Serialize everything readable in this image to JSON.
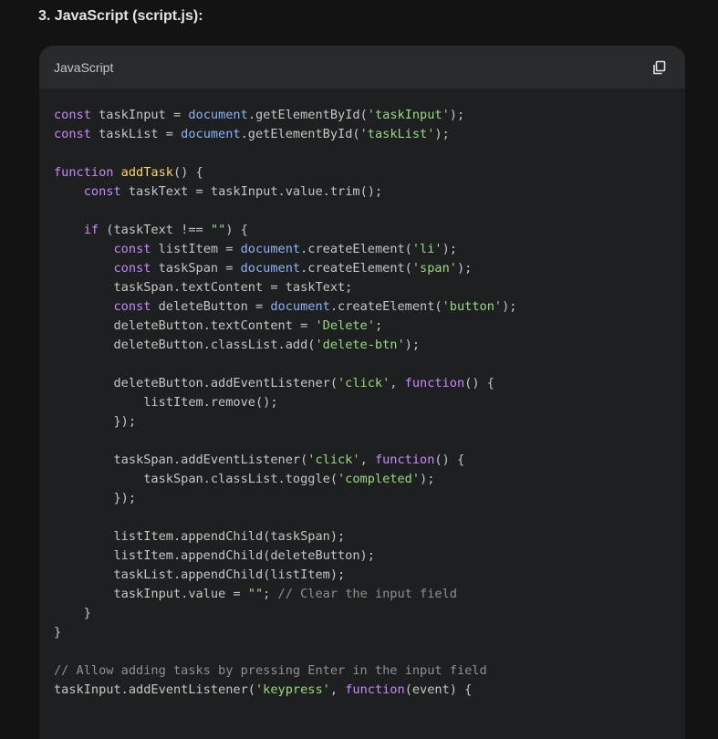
{
  "heading": "3. JavaScript (script.js):",
  "code_block": {
    "language": "JavaScript",
    "copy_icon": "copy-icon",
    "lines": [
      [
        {
          "t": "kw",
          "v": "const"
        },
        {
          "t": "tx",
          "v": " taskInput = "
        },
        {
          "t": "gl",
          "v": "document"
        },
        {
          "t": "tx",
          "v": ".getElementById("
        },
        {
          "t": "st",
          "v": "'taskInput'"
        },
        {
          "t": "tx",
          "v": ");"
        }
      ],
      [
        {
          "t": "kw",
          "v": "const"
        },
        {
          "t": "tx",
          "v": " taskList = "
        },
        {
          "t": "gl",
          "v": "document"
        },
        {
          "t": "tx",
          "v": ".getElementById("
        },
        {
          "t": "st",
          "v": "'taskList'"
        },
        {
          "t": "tx",
          "v": ");"
        }
      ],
      [],
      [
        {
          "t": "kw",
          "v": "function"
        },
        {
          "t": "tx",
          "v": " "
        },
        {
          "t": "fn",
          "v": "addTask"
        },
        {
          "t": "tx",
          "v": "() {"
        }
      ],
      [
        {
          "t": "tx",
          "v": "    "
        },
        {
          "t": "kw",
          "v": "const"
        },
        {
          "t": "tx",
          "v": " taskText = taskInput.value.trim();"
        }
      ],
      [],
      [
        {
          "t": "tx",
          "v": "    "
        },
        {
          "t": "kw",
          "v": "if"
        },
        {
          "t": "tx",
          "v": " (taskText !== "
        },
        {
          "t": "st",
          "v": "\"\""
        },
        {
          "t": "tx",
          "v": ") {"
        }
      ],
      [
        {
          "t": "tx",
          "v": "        "
        },
        {
          "t": "kw",
          "v": "const"
        },
        {
          "t": "tx",
          "v": " listItem = "
        },
        {
          "t": "gl",
          "v": "document"
        },
        {
          "t": "tx",
          "v": ".createElement("
        },
        {
          "t": "st",
          "v": "'li'"
        },
        {
          "t": "tx",
          "v": ");"
        }
      ],
      [
        {
          "t": "tx",
          "v": "        "
        },
        {
          "t": "kw",
          "v": "const"
        },
        {
          "t": "tx",
          "v": " taskSpan = "
        },
        {
          "t": "gl",
          "v": "document"
        },
        {
          "t": "tx",
          "v": ".createElement("
        },
        {
          "t": "st",
          "v": "'span'"
        },
        {
          "t": "tx",
          "v": ");"
        }
      ],
      [
        {
          "t": "tx",
          "v": "        taskSpan.textContent = taskText;"
        }
      ],
      [
        {
          "t": "tx",
          "v": "        "
        },
        {
          "t": "kw",
          "v": "const"
        },
        {
          "t": "tx",
          "v": " deleteButton = "
        },
        {
          "t": "gl",
          "v": "document"
        },
        {
          "t": "tx",
          "v": ".createElement("
        },
        {
          "t": "st",
          "v": "'button'"
        },
        {
          "t": "tx",
          "v": ");"
        }
      ],
      [
        {
          "t": "tx",
          "v": "        deleteButton.textContent = "
        },
        {
          "t": "st",
          "v": "'Delete'"
        },
        {
          "t": "tx",
          "v": ";"
        }
      ],
      [
        {
          "t": "tx",
          "v": "        deleteButton.classList.add("
        },
        {
          "t": "st",
          "v": "'delete-btn'"
        },
        {
          "t": "tx",
          "v": ");"
        }
      ],
      [],
      [
        {
          "t": "tx",
          "v": "        deleteButton.addEventListener("
        },
        {
          "t": "st",
          "v": "'click'"
        },
        {
          "t": "tx",
          "v": ", "
        },
        {
          "t": "kw",
          "v": "function"
        },
        {
          "t": "tx",
          "v": "() {"
        }
      ],
      [
        {
          "t": "tx",
          "v": "            listItem.remove();"
        }
      ],
      [
        {
          "t": "tx",
          "v": "        });"
        }
      ],
      [],
      [
        {
          "t": "tx",
          "v": "        taskSpan.addEventListener("
        },
        {
          "t": "st",
          "v": "'click'"
        },
        {
          "t": "tx",
          "v": ", "
        },
        {
          "t": "kw",
          "v": "function"
        },
        {
          "t": "tx",
          "v": "() {"
        }
      ],
      [
        {
          "t": "tx",
          "v": "            taskSpan.classList.toggle("
        },
        {
          "t": "st",
          "v": "'completed'"
        },
        {
          "t": "tx",
          "v": ");"
        }
      ],
      [
        {
          "t": "tx",
          "v": "        });"
        }
      ],
      [],
      [
        {
          "t": "tx",
          "v": "        listItem.appendChild(taskSpan);"
        }
      ],
      [
        {
          "t": "tx",
          "v": "        listItem.appendChild(deleteButton);"
        }
      ],
      [
        {
          "t": "tx",
          "v": "        taskList.appendChild(listItem);"
        }
      ],
      [
        {
          "t": "tx",
          "v": "        taskInput.value = "
        },
        {
          "t": "st",
          "v": "\"\""
        },
        {
          "t": "tx",
          "v": "; "
        },
        {
          "t": "cm",
          "v": "// Clear the input field"
        }
      ],
      [
        {
          "t": "tx",
          "v": "    }"
        }
      ],
      [
        {
          "t": "tx",
          "v": "}"
        }
      ],
      [],
      [
        {
          "t": "cm",
          "v": "// Allow adding tasks by pressing Enter in the input field"
        }
      ],
      [
        {
          "t": "tx",
          "v": "taskInput.addEventListener("
        },
        {
          "t": "st",
          "v": "'keypress'"
        },
        {
          "t": "tx",
          "v": ", "
        },
        {
          "t": "kw",
          "v": "function"
        },
        {
          "t": "tx",
          "v": "(event) {"
        }
      ]
    ]
  },
  "colors": {
    "background": "#131314",
    "code_background": "#1e1f20",
    "header_background": "#282a2c",
    "keyword": "#c58af9",
    "global": "#8ab4f8",
    "string": "#98d982",
    "function_name": "#fdd663",
    "comment": "#8e918f",
    "text": "#c4c7c5"
  }
}
